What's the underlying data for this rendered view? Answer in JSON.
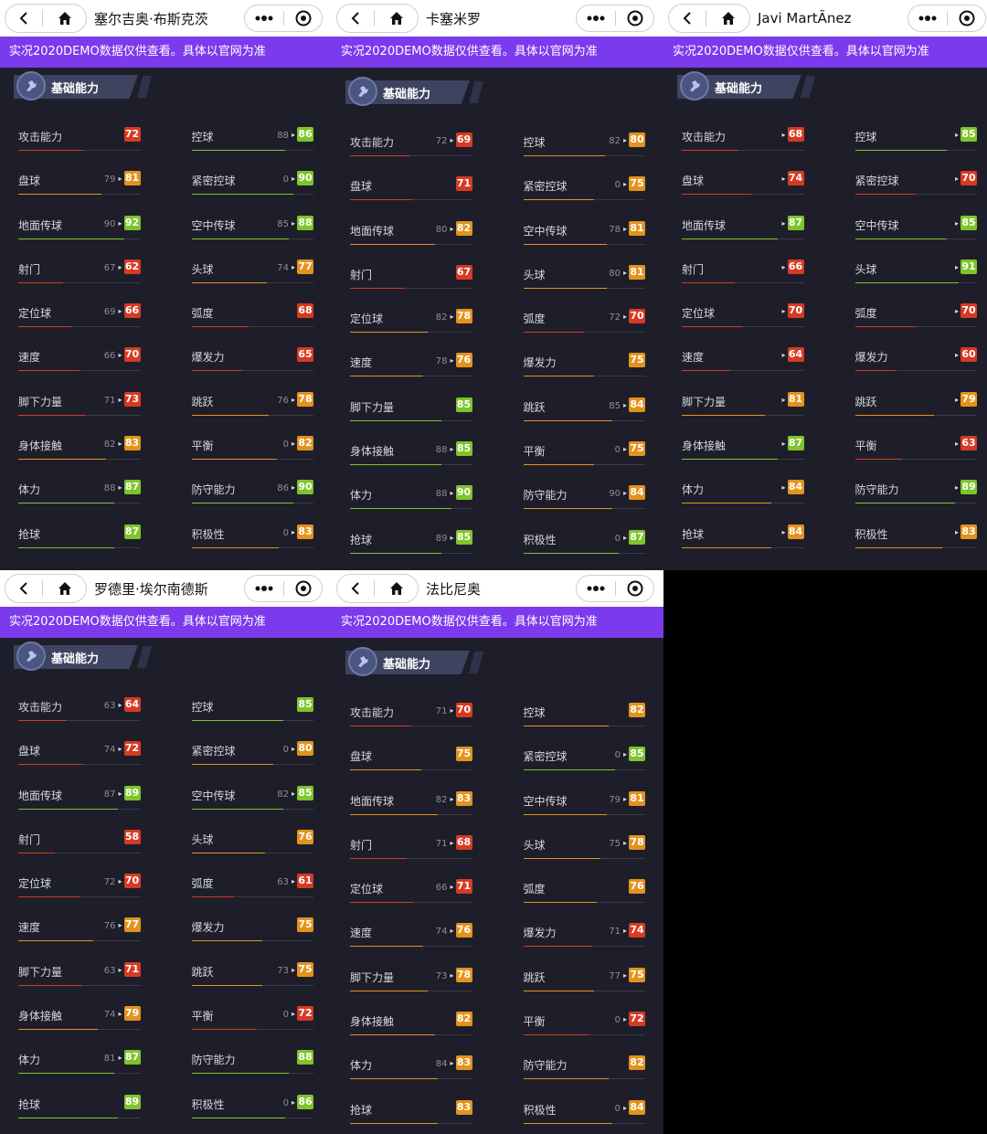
{
  "common": {
    "banner": "实况2020DEMO数据仅供查看。具体以官网为准",
    "section_label": "基础能力",
    "arrow_glyph": "▸",
    "colors": {
      "red": "#d63a23",
      "orange": "#e3931c",
      "green": "#7ec42b",
      "banner": "#7c3aed"
    }
  },
  "panels": [
    {
      "title": "塞尔吉奥·布斯克茨",
      "left": [
        {
          "name": "攻击能力",
          "base": "",
          "value": "72",
          "color": "red"
        },
        {
          "name": "盘球",
          "base": "79",
          "value": "81",
          "color": "orange"
        },
        {
          "name": "地面传球",
          "base": "90",
          "value": "92",
          "color": "green"
        },
        {
          "name": "射门",
          "base": "67",
          "value": "62",
          "color": "red"
        },
        {
          "name": "定位球",
          "base": "69",
          "value": "66",
          "color": "red"
        },
        {
          "name": "速度",
          "base": "66",
          "value": "70",
          "color": "red"
        },
        {
          "name": "脚下力量",
          "base": "71",
          "value": "73",
          "color": "red"
        },
        {
          "name": "身体接触",
          "base": "82",
          "value": "83",
          "color": "orange"
        },
        {
          "name": "体力",
          "base": "88",
          "value": "87",
          "color": "green"
        },
        {
          "name": "抢球",
          "base": "",
          "value": "87",
          "color": "green"
        }
      ],
      "right": [
        {
          "name": "控球",
          "base": "88",
          "value": "86",
          "color": "green"
        },
        {
          "name": "紧密控球",
          "base": "0",
          "value": "90",
          "color": "green"
        },
        {
          "name": "空中传球",
          "base": "85",
          "value": "88",
          "color": "green"
        },
        {
          "name": "头球",
          "base": "74",
          "value": "77",
          "color": "orange"
        },
        {
          "name": "弧度",
          "base": "",
          "value": "68",
          "color": "red"
        },
        {
          "name": "爆发力",
          "base": "",
          "value": "65",
          "color": "red"
        },
        {
          "name": "跳跃",
          "base": "76",
          "value": "78",
          "color": "orange"
        },
        {
          "name": "平衡",
          "base": "0",
          "value": "82",
          "color": "orange"
        },
        {
          "name": "防守能力",
          "base": "86",
          "value": "90",
          "color": "green"
        },
        {
          "name": "积极性",
          "base": "0",
          "value": "83",
          "color": "orange"
        }
      ]
    },
    {
      "title": "卡塞米罗",
      "left": [
        {
          "name": "攻击能力",
          "base": "72",
          "value": "69",
          "color": "red"
        },
        {
          "name": "盘球",
          "base": "",
          "value": "71",
          "color": "red"
        },
        {
          "name": "地面传球",
          "base": "80",
          "value": "82",
          "color": "orange"
        },
        {
          "name": "射门",
          "base": "",
          "value": "67",
          "color": "red"
        },
        {
          "name": "定位球",
          "base": "82",
          "value": "78",
          "color": "orange"
        },
        {
          "name": "速度",
          "base": "78",
          "value": "76",
          "color": "orange"
        },
        {
          "name": "脚下力量",
          "base": "",
          "value": "85",
          "color": "green"
        },
        {
          "name": "身体接触",
          "base": "88",
          "value": "85",
          "color": "green"
        },
        {
          "name": "体力",
          "base": "88",
          "value": "90",
          "color": "green"
        },
        {
          "name": "抢球",
          "base": "89",
          "value": "85",
          "color": "green"
        }
      ],
      "right": [
        {
          "name": "控球",
          "base": "82",
          "value": "80",
          "color": "orange"
        },
        {
          "name": "紧密控球",
          "base": "0",
          "value": "75",
          "color": "orange"
        },
        {
          "name": "空中传球",
          "base": "78",
          "value": "81",
          "color": "orange"
        },
        {
          "name": "头球",
          "base": "80",
          "value": "81",
          "color": "orange"
        },
        {
          "name": "弧度",
          "base": "72",
          "value": "70",
          "color": "red"
        },
        {
          "name": "爆发力",
          "base": "",
          "value": "75",
          "color": "orange"
        },
        {
          "name": "跳跃",
          "base": "85",
          "value": "84",
          "color": "orange"
        },
        {
          "name": "平衡",
          "base": "0",
          "value": "75",
          "color": "orange"
        },
        {
          "name": "防守能力",
          "base": "90",
          "value": "84",
          "color": "orange"
        },
        {
          "name": "积极性",
          "base": "0",
          "value": "87",
          "color": "green"
        }
      ]
    },
    {
      "title": "Javi MartÃnez",
      "left": [
        {
          "name": "攻击能力",
          "base": "",
          "value": "68",
          "color": "red"
        },
        {
          "name": "盘球",
          "base": "",
          "value": "74",
          "color": "red"
        },
        {
          "name": "地面传球",
          "base": "",
          "value": "87",
          "color": "green"
        },
        {
          "name": "射门",
          "base": "",
          "value": "66",
          "color": "red"
        },
        {
          "name": "定位球",
          "base": "",
          "value": "70",
          "color": "red"
        },
        {
          "name": "速度",
          "base": "",
          "value": "64",
          "color": "red"
        },
        {
          "name": "脚下力量",
          "base": "",
          "value": "81",
          "color": "orange"
        },
        {
          "name": "身体接触",
          "base": "",
          "value": "87",
          "color": "green"
        },
        {
          "name": "体力",
          "base": "",
          "value": "84",
          "color": "orange"
        },
        {
          "name": "抢球",
          "base": "",
          "value": "84",
          "color": "orange"
        }
      ],
      "right": [
        {
          "name": "控球",
          "base": "",
          "value": "85",
          "color": "green"
        },
        {
          "name": "紧密控球",
          "base": "",
          "value": "70",
          "color": "red"
        },
        {
          "name": "空中传球",
          "base": "",
          "value": "85",
          "color": "green"
        },
        {
          "name": "头球",
          "base": "",
          "value": "91",
          "color": "green"
        },
        {
          "name": "弧度",
          "base": "",
          "value": "70",
          "color": "red"
        },
        {
          "name": "爆发力",
          "base": "",
          "value": "60",
          "color": "red"
        },
        {
          "name": "跳跃",
          "base": "",
          "value": "79",
          "color": "orange"
        },
        {
          "name": "平衡",
          "base": "",
          "value": "63",
          "color": "red"
        },
        {
          "name": "防守能力",
          "base": "",
          "value": "89",
          "color": "green"
        },
        {
          "name": "积极性",
          "base": "",
          "value": "83",
          "color": "orange"
        }
      ]
    },
    {
      "title": "罗德里·埃尔南德斯",
      "left": [
        {
          "name": "攻击能力",
          "base": "63",
          "value": "64",
          "color": "red"
        },
        {
          "name": "盘球",
          "base": "74",
          "value": "72",
          "color": "red"
        },
        {
          "name": "地面传球",
          "base": "87",
          "value": "89",
          "color": "green"
        },
        {
          "name": "射门",
          "base": "",
          "value": "58",
          "color": "red"
        },
        {
          "name": "定位球",
          "base": "72",
          "value": "70",
          "color": "red"
        },
        {
          "name": "速度",
          "base": "76",
          "value": "77",
          "color": "orange"
        },
        {
          "name": "脚下力量",
          "base": "63",
          "value": "71",
          "color": "red"
        },
        {
          "name": "身体接触",
          "base": "74",
          "value": "79",
          "color": "orange"
        },
        {
          "name": "体力",
          "base": "81",
          "value": "87",
          "color": "green"
        },
        {
          "name": "抢球",
          "base": "",
          "value": "89",
          "color": "green"
        }
      ],
      "right": [
        {
          "name": "控球",
          "base": "",
          "value": "85",
          "color": "green"
        },
        {
          "name": "紧密控球",
          "base": "0",
          "value": "80",
          "color": "orange"
        },
        {
          "name": "空中传球",
          "base": "82",
          "value": "85",
          "color": "green"
        },
        {
          "name": "头球",
          "base": "",
          "value": "76",
          "color": "orange"
        },
        {
          "name": "弧度",
          "base": "63",
          "value": "61",
          "color": "red"
        },
        {
          "name": "爆发力",
          "base": "",
          "value": "75",
          "color": "orange"
        },
        {
          "name": "跳跃",
          "base": "73",
          "value": "75",
          "color": "orange"
        },
        {
          "name": "平衡",
          "base": "0",
          "value": "72",
          "color": "red"
        },
        {
          "name": "防守能力",
          "base": "",
          "value": "88",
          "color": "green"
        },
        {
          "name": "积极性",
          "base": "0",
          "value": "86",
          "color": "green"
        }
      ]
    },
    {
      "title": "法比尼奥",
      "left": [
        {
          "name": "攻击能力",
          "base": "71",
          "value": "70",
          "color": "red"
        },
        {
          "name": "盘球",
          "base": "",
          "value": "75",
          "color": "orange"
        },
        {
          "name": "地面传球",
          "base": "82",
          "value": "83",
          "color": "orange"
        },
        {
          "name": "射门",
          "base": "71",
          "value": "68",
          "color": "red"
        },
        {
          "name": "定位球",
          "base": "66",
          "value": "71",
          "color": "red"
        },
        {
          "name": "速度",
          "base": "74",
          "value": "76",
          "color": "orange"
        },
        {
          "name": "脚下力量",
          "base": "73",
          "value": "78",
          "color": "orange"
        },
        {
          "name": "身体接触",
          "base": "",
          "value": "82",
          "color": "orange"
        },
        {
          "name": "体力",
          "base": "84",
          "value": "83",
          "color": "orange"
        },
        {
          "name": "抢球",
          "base": "",
          "value": "83",
          "color": "orange"
        }
      ],
      "right": [
        {
          "name": "控球",
          "base": "",
          "value": "82",
          "color": "orange"
        },
        {
          "name": "紧密控球",
          "base": "0",
          "value": "85",
          "color": "green"
        },
        {
          "name": "空中传球",
          "base": "79",
          "value": "81",
          "color": "orange"
        },
        {
          "name": "头球",
          "base": "75",
          "value": "78",
          "color": "orange"
        },
        {
          "name": "弧度",
          "base": "",
          "value": "76",
          "color": "orange"
        },
        {
          "name": "爆发力",
          "base": "71",
          "value": "74",
          "color": "red"
        },
        {
          "name": "跳跃",
          "base": "77",
          "value": "75",
          "color": "orange"
        },
        {
          "name": "平衡",
          "base": "0",
          "value": "72",
          "color": "red"
        },
        {
          "name": "防守能力",
          "base": "",
          "value": "82",
          "color": "orange"
        },
        {
          "name": "积极性",
          "base": "0",
          "value": "84",
          "color": "orange"
        }
      ]
    }
  ]
}
